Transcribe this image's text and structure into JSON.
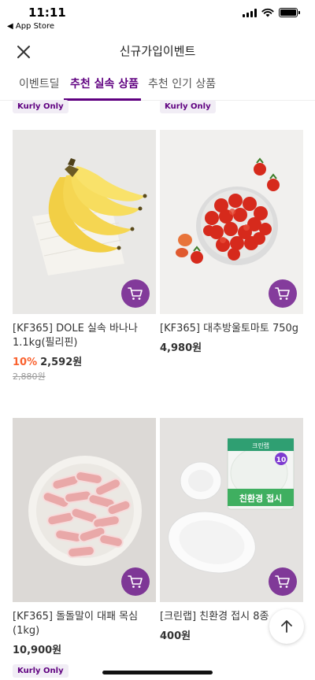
{
  "status_bar": {
    "time": "11:11",
    "back_app": "◀ App Store"
  },
  "header": {
    "title": "신규가입이벤트"
  },
  "tabs": [
    {
      "label": "이벤트딜",
      "active": false
    },
    {
      "label": "추천 실속 상품",
      "active": true
    },
    {
      "label": "추천 인기 상품",
      "active": false
    }
  ],
  "accent": "#5f0080",
  "discount_color": "#fa622f",
  "top_badges": [
    "Kurly Only",
    "Kurly Only"
  ],
  "products": [
    {
      "name": "[KF365] DOLE 실속 바나나 1.1kg(필리핀)",
      "discount": "10%",
      "price": "2,592원",
      "original_price": "2,880원",
      "badge": "",
      "image": "banana-image"
    },
    {
      "name": "[KF365] 대추방울토마토 750g",
      "discount": "",
      "price": "4,980원",
      "original_price": "",
      "badge": "",
      "image": "cherry-tomato-image"
    },
    {
      "name": "[KF365] 돌돌말이 대패 목심(1kg)",
      "discount": "",
      "price": "10,900원",
      "original_price": "",
      "badge": "Kurly Only",
      "image": "pork-roll-image"
    },
    {
      "name": "[크린랩] 친환경 접시 8종",
      "discount": "",
      "price": "400원",
      "original_price": "",
      "badge": "",
      "image": "plates-image"
    }
  ],
  "plate_package": {
    "label": "친환경 접시",
    "count": "10",
    "brand": "크린랩"
  },
  "icons": [
    "close-icon",
    "cart-icon",
    "arrow-up-icon"
  ]
}
